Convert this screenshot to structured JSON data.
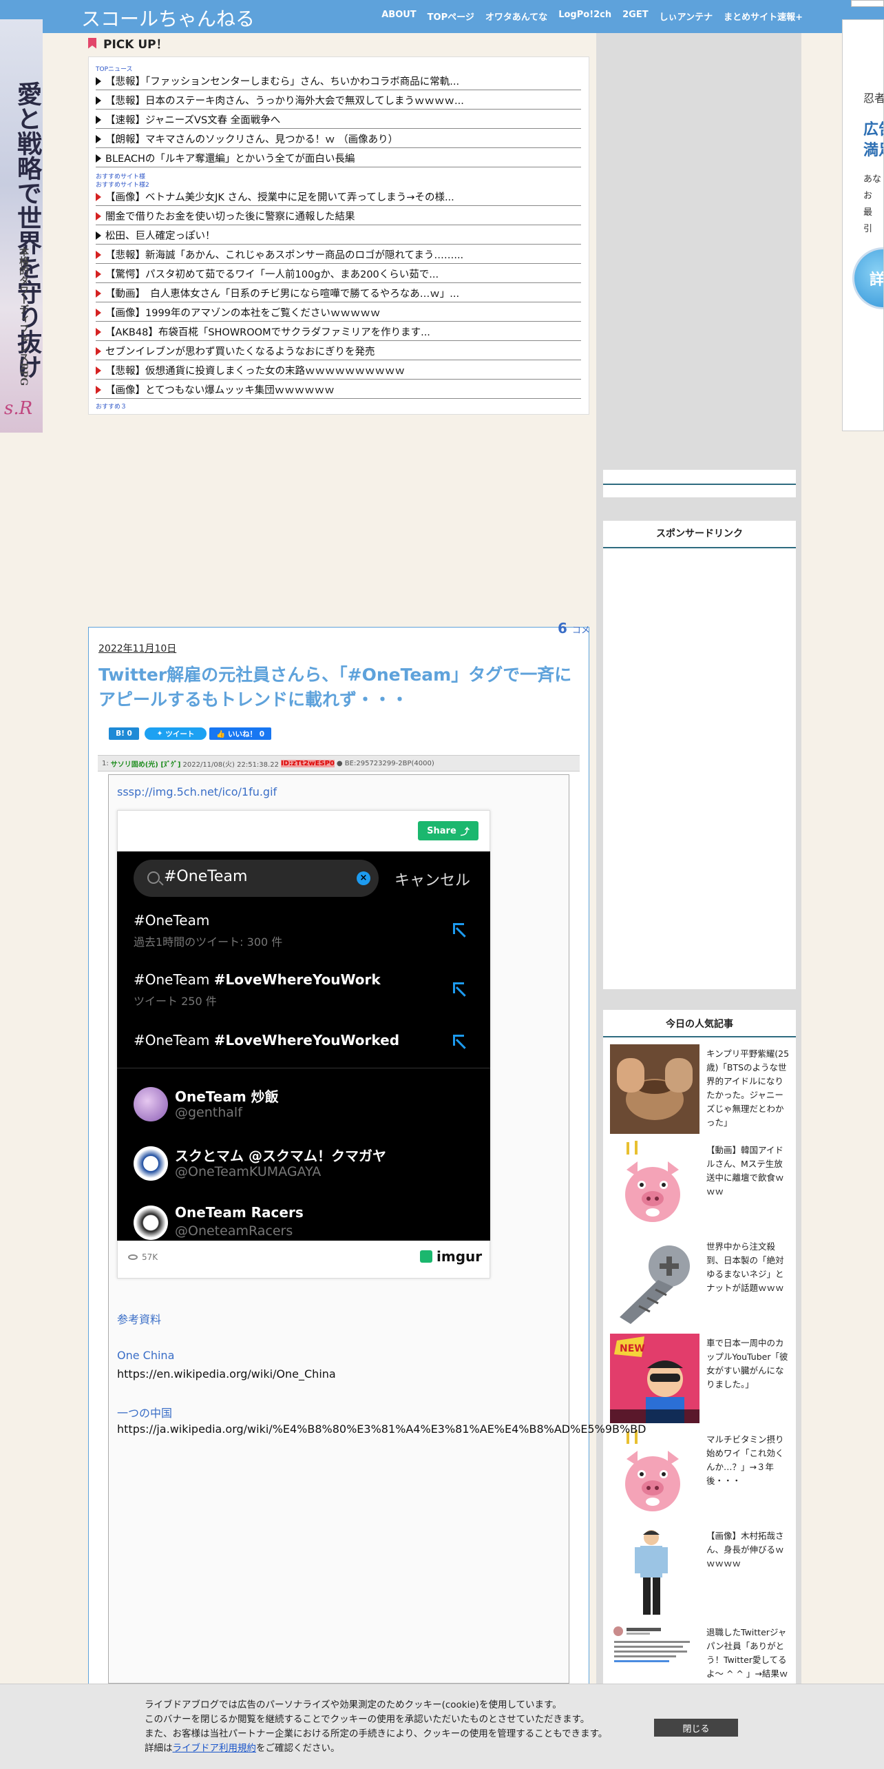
{
  "header": {
    "site_title": "スコールちゃんねる",
    "nav": [
      "ABOUT",
      "TOPページ",
      "オワタあんてな",
      "LogPo!2ch",
      "2GET",
      "しぃアンテナ",
      "まとめサイト速報+"
    ]
  },
  "left_banner": {
    "headline": "愛と戦略で世界を守り抜け",
    "subline": "本格的タワーディフェンスRPG",
    "logo": "s.R"
  },
  "right_banner": {
    "line1": "忍者",
    "line2a": "広告",
    "line2b": "満足",
    "lines3": [
      "あな",
      "お",
      "最",
      "引"
    ],
    "button": "詳"
  },
  "pickup": {
    "title": "PICK UP！",
    "label_top": "TOPニュース",
    "items_a": [
      {
        "text": "【悲報】「ファッションセンターしまむら」さん、ちいかわコラボ商品に常軌...",
        "mark": "black"
      },
      {
        "text": "【悲報】日本のステーキ肉さん、うっかり海外大会で無双してしまうｗｗｗｗ...",
        "mark": "black"
      },
      {
        "text": "【速報】ジャニーズVS文春 全面戦争へ",
        "mark": "black"
      },
      {
        "text": "【朗報】マキマさんのソックリさん、見つかる！ｗ （画像あり）",
        "mark": "black"
      },
      {
        "text": "BLEACHの「ルキア奪還編」とかいう全てが面白い長編",
        "mark": "black"
      }
    ],
    "label_mid1": "おすすめサイト様",
    "label_mid2": "おすすめサイト様2",
    "items_b": [
      {
        "text": "【画像】ベトナム美少女JK さん、授業中に足を開いて弄ってしまう→その様...",
        "mark": "red"
      },
      {
        "text": "闇金で借りたお金を使い切った後に警察に通報した結果",
        "mark": "red"
      },
      {
        "text": "松田、巨人確定っぽい！",
        "mark": "black"
      },
      {
        "text": "【悲報】新海誠「あかん、これじゃあスポンサー商品のロゴが隠れてまう……...",
        "mark": "red"
      },
      {
        "text": "【驚愕】パスタ初めて茹でるワイ「一人前100gか、まあ200くらい茹で...",
        "mark": "red"
      },
      {
        "text": "【動画】　白人恵体女さん「日系のチビ男になら喧嘩で勝てるやろなあ…ｗ」...",
        "mark": "red"
      },
      {
        "text": "【画像】1999年のアマゾンの本社をご覧くださいｗｗｗｗｗ",
        "mark": "red"
      },
      {
        "text": "【AKB48】布袋百椛「SHOWROOMでサクラダファミリアを作ります...",
        "mark": "red"
      },
      {
        "text": "セブンイレブンが思わず買いたくなるようなおにぎりを発売",
        "mark": "red"
      },
      {
        "text": "【悲報】仮想通貨に投資しまくった女の末路ｗｗｗｗｗｗｗｗｗｗ",
        "mark": "red"
      },
      {
        "text": "【画像】とてつもない爆ムッッキ集団ｗｗｗｗｗｗ",
        "mark": "red"
      }
    ],
    "label_bottom": "おすすめ３"
  },
  "sidebar": {
    "sponsor_title": "スポンサードリンク",
    "popular_title": "今日の人気記事",
    "popular": [
      {
        "text": "キンプリ平野紫耀(25歳)「BTSのような世界的アイドルになりたかった。ジャニーズじゃ無理だとわかった」",
        "thumb": "pottery"
      },
      {
        "text": "【動画】韓国アイドルさん、Mステ生放送中に離壇で飲食ｗｗｗ",
        "thumb": "pig"
      },
      {
        "text": "世界中から注文殺到、日本製の「絶対ゆるまないネジ」とナットが話題ｗｗｗ",
        "thumb": "screw"
      },
      {
        "text": "車で日本一周中のカップルYouTuber「彼女がすい臓がんになりました。」",
        "thumb": "youtuber"
      },
      {
        "text": "マルチビタミン摂り始めワイ「これ効くんか…？」→３年後・・・",
        "thumb": "pig"
      },
      {
        "text": "【画像】木村拓哉さん、身長が伸びるｗｗｗｗｗ",
        "thumb": "man"
      },
      {
        "text": "退職したTwitterジャパン社員「ありがとう！Twitter愛してるよ～ ^ ^ 」→結果ｗ",
        "thumb": "tweet"
      }
    ]
  },
  "article": {
    "comment_count": "6",
    "comment_label": "コメ",
    "date": "2022年11月10日",
    "title": "Twitter解雇の元社員さんら、「#OneTeam」タグで一斉にアピールするもトレンドに載れず・・・",
    "share": {
      "hatena": "B! 0",
      "tweet": "ツイート",
      "like": "いいね！ 0"
    },
    "res": {
      "num": "1:",
      "name": "サソリ固め(光) [ﾇﾞｸﾞ]",
      "datetime": "2022/11/08(火) 22:51:38.22",
      "id": "ID:zTt2wESP0",
      "be": "● BE:295723299-2BP(4000)"
    },
    "image_link": "sssp://img.5ch.net/ico/1fu.gif",
    "embed": {
      "share_label": "Share",
      "search_query": "#OneTeam",
      "cancel": "キャンセル",
      "trends": [
        {
          "main": "#OneTeam",
          "bold": "",
          "sub": "過去1時間のツイート: 300 件"
        },
        {
          "main": "#OneTeam ",
          "bold": "#LoveWhereYouWork",
          "sub": "ツイート 250 件"
        },
        {
          "main": "#OneTeam ",
          "bold": "#LoveWhereYouWorked",
          "sub": ""
        }
      ],
      "accounts": [
        {
          "name": "OneTeam 炒飯",
          "handle": "@genthalf"
        },
        {
          "name": "スクとマム @スクマム！クマガヤ",
          "handle": "@OneTeamKUMAGAYA"
        },
        {
          "name": "OneTeam Racers",
          "handle": "@OneteamRacers"
        }
      ],
      "views": "57K",
      "brand": "imgur"
    },
    "refs_heading": "参考資料",
    "ref1_title": "One China",
    "ref1_url": "https://en.wikipedia.org/wiki/One_China",
    "ref2_title": "一つの中国",
    "ref2_url": "https://ja.wikipedia.org/wiki/%E4%B8%80%E3%81%A4%E3%81%AE%E4%B8%AD%E5%9B%BD"
  },
  "cookie": {
    "line1": "ライブドアブログでは広告のパーソナライズや効果測定のためクッキー(cookie)を使用しています。",
    "line2": "このバナーを閉じるか閲覧を継続することでクッキーの使用を承認いただいたものとさせていただきます。",
    "line3": "また、お客様は当社パートナー企業における所定の手続きにより、クッキーの使用を管理することもできます。",
    "line4_pre": "詳細は",
    "line4_link": "ライブドア利用規約",
    "line4_post": "をご確認ください。",
    "close": "閉じる"
  },
  "colors": {
    "header": "#5ea2db",
    "title": "#5ea2db",
    "link": "#3a6ec7",
    "accent_red": "#d52222"
  }
}
